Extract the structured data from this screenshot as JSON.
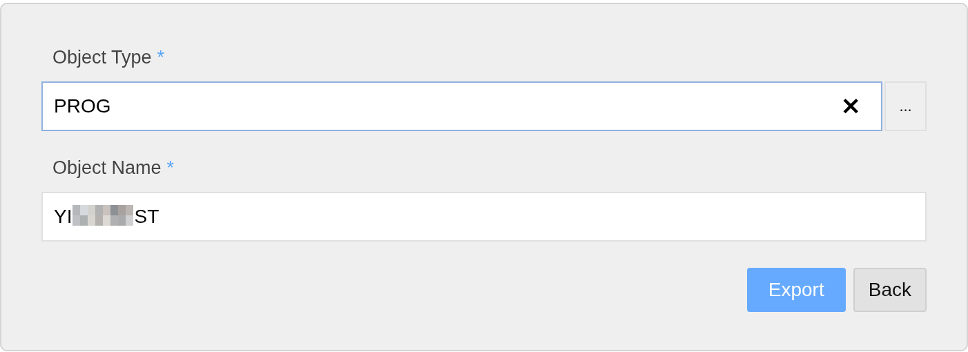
{
  "fields": [
    {
      "kind": "lookup",
      "label": "Object Type",
      "required_mark": "*",
      "value": "PROG",
      "focused": true,
      "clear_icon": "✕",
      "browse_button": "..."
    },
    {
      "kind": "text",
      "label": "Object Name",
      "required_mark": "*",
      "value_parts": [
        "YI",
        "ST"
      ],
      "focused": false
    }
  ],
  "buttons": [
    {
      "label": "Export",
      "primary": true
    },
    {
      "label": "Back",
      "primary": false
    }
  ]
}
